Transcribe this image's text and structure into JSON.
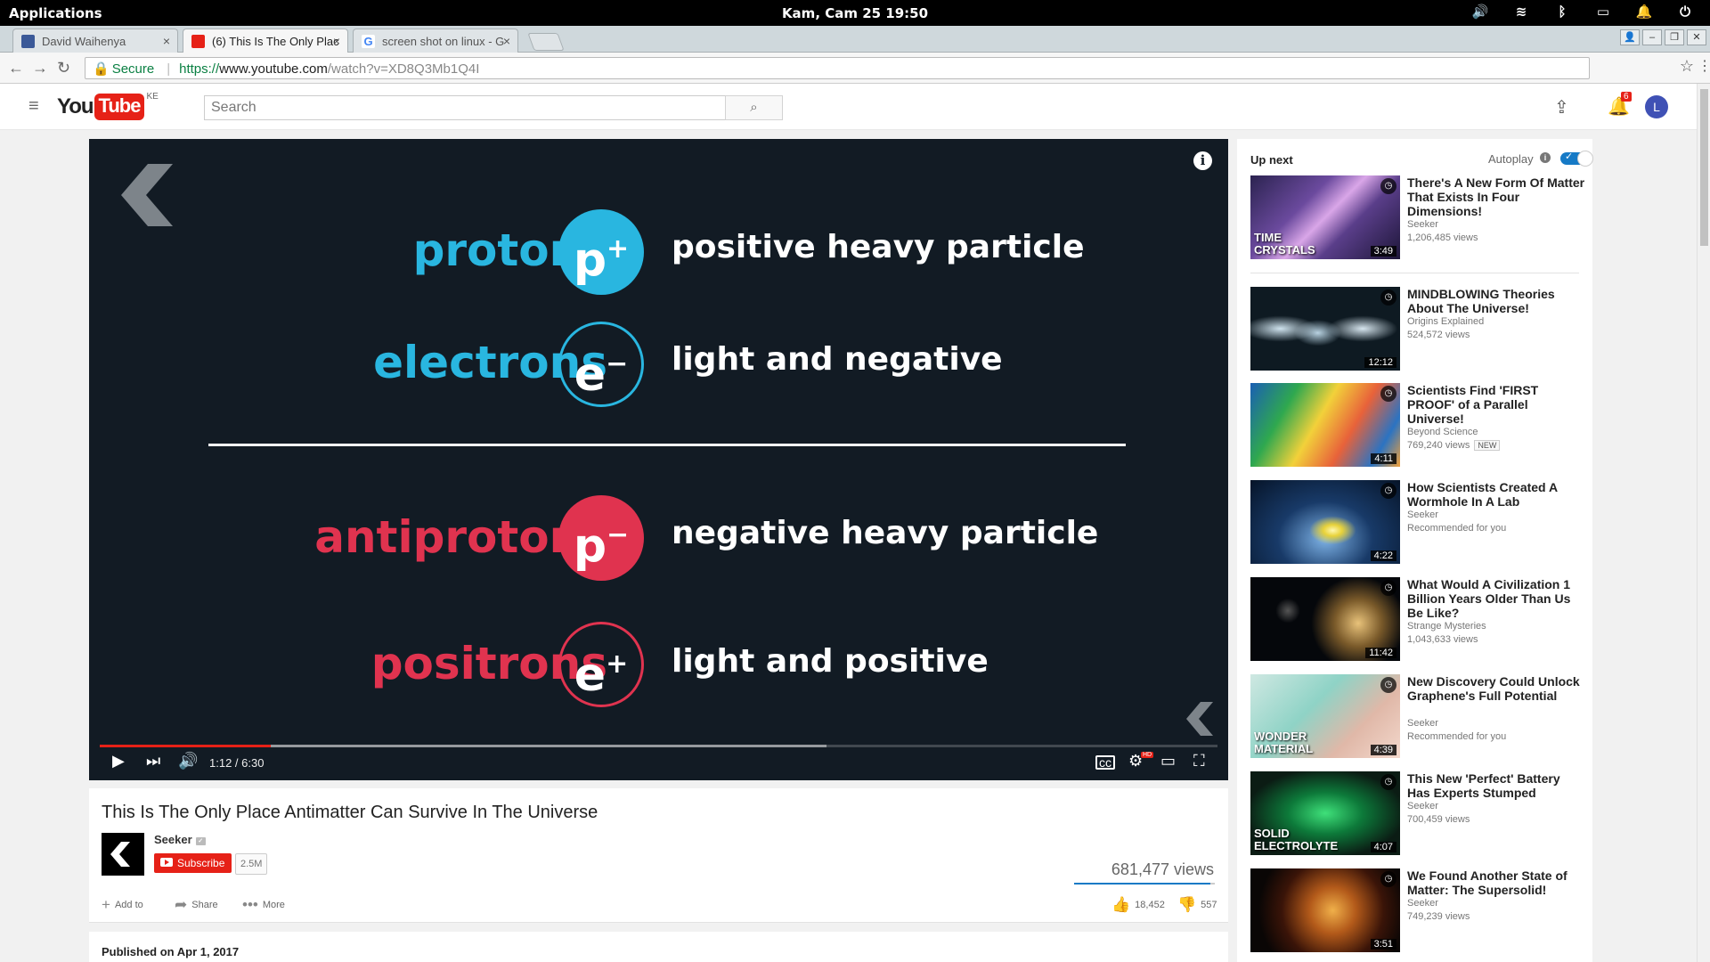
{
  "os": {
    "apps": "Applications",
    "clock": "Kam, Cam 25   19:50"
  },
  "browser": {
    "tabs": [
      {
        "label": "David Waihenya",
        "favicon_color": "#3b5998"
      },
      {
        "label": "(6) This Is The Only Plac",
        "favicon_color": "#e62117"
      },
      {
        "label": "screen shot on linux - G",
        "favicon_color": "#4285f4"
      }
    ],
    "address": {
      "secure": "Secure",
      "protocol": "https://",
      "host": "www.youtube.com",
      "path": "/watch?v=XD8Q3Mb1Q4I"
    }
  },
  "youtube": {
    "country": "KE",
    "search_placeholder": "Search",
    "notifications": "6",
    "avatar_letter": "L"
  },
  "video": {
    "slide": {
      "rows": [
        {
          "term": "protons",
          "symbol": "p",
          "charge": "+",
          "desc": "positive heavy particle"
        },
        {
          "term": "electrons",
          "symbol": "e",
          "charge": "−",
          "desc": "light and negative"
        },
        {
          "term": "antiprotons",
          "symbol": "p",
          "charge": "−",
          "desc": "negative heavy particle"
        },
        {
          "term": "positrons",
          "symbol": "e",
          "charge": "+",
          "desc": "light and positive"
        }
      ]
    },
    "progress_played": 0.153,
    "progress_loaded": 0.65,
    "time": "1:12 / 6:30",
    "title": "This Is The Only Place Antimatter Can Survive In The Universe",
    "channel": "Seeker",
    "subscribe": "Subscribe",
    "subscribers": "2.5M",
    "views": "681,477 views",
    "like_ratio": 0.971,
    "actions": {
      "add": "Add to",
      "share": "Share",
      "more": "More"
    },
    "likes": "18,452",
    "dislikes": "557",
    "published": "Published on Apr 1, 2017"
  },
  "sidebar": {
    "up_next": "Up next",
    "autoplay": "Autoplay",
    "autoplay_on": true,
    "videos": [
      {
        "title": "There's A New Form Of Matter That Exists In Four Dimensions!",
        "channel": "Seeker",
        "meta": "1,206,485 views",
        "duration": "3:49",
        "caption": "TIME\nCRYSTALS",
        "thumb": "crystal"
      },
      {
        "title": "MINDBLOWING Theories About The Universe!",
        "channel": "Origins Explained",
        "meta": "524,572 views",
        "duration": "12:12",
        "caption": "",
        "thumb": "ghost"
      },
      {
        "title": "Scientists Find 'FIRST PROOF' of a Parallel Universe!",
        "channel": "Beyond Science",
        "meta": "769,240 views",
        "badge": "NEW",
        "duration": "4:11",
        "caption": "",
        "thumb": "cmb"
      },
      {
        "title": "How Scientists Created A Wormhole In A Lab",
        "channel": "Seeker",
        "meta": "Recommended for you",
        "duration": "4:22",
        "caption": "",
        "thumb": "wormhole"
      },
      {
        "title": "What Would A Civilization 1 Billion Years Older Than Us Be Like?",
        "channel": "Strange Mysteries",
        "meta": "1,043,633 views",
        "duration": "11:42",
        "caption": "",
        "thumb": "space"
      },
      {
        "title": "New Discovery Could Unlock Graphene's Full Potential",
        "channel": "Seeker",
        "meta": "Recommended for you",
        "duration": "4:39",
        "caption": "WONDER\nMATERIAL",
        "thumb": "graphene"
      },
      {
        "title": "This New 'Perfect' Battery Has Experts Stumped",
        "channel": "Seeker",
        "meta": "700,459 views",
        "duration": "4:07",
        "caption": "SOLID\nELECTROLYTE",
        "thumb": "battery"
      },
      {
        "title": "We Found Another State of Matter: The Supersolid!",
        "channel": "Seeker",
        "meta": "749,239 views",
        "duration": "3:51",
        "caption": "",
        "thumb": "supersolid"
      }
    ]
  }
}
